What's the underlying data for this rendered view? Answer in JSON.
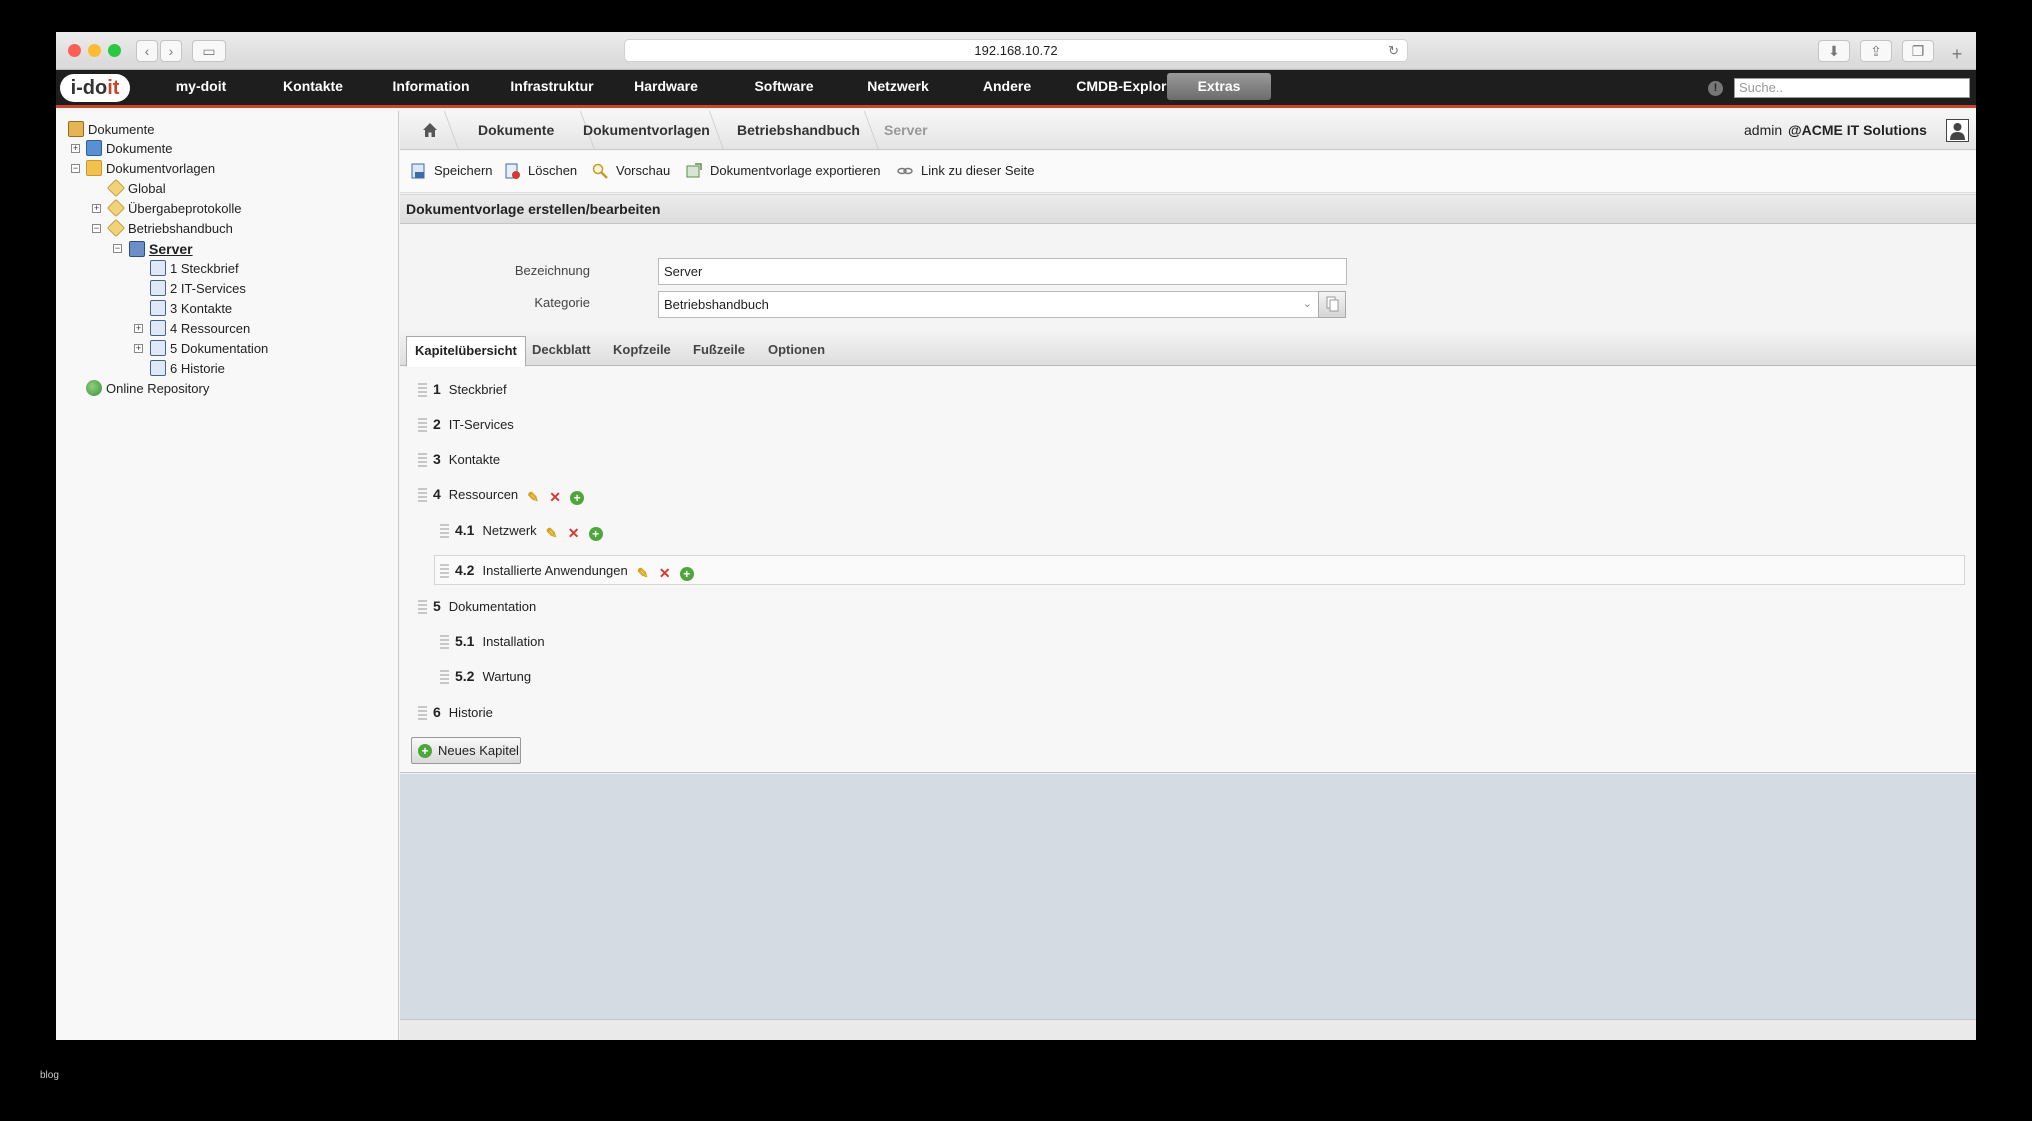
{
  "browser": {
    "url": "192.168.10.72"
  },
  "nav": {
    "logo": "i-doit",
    "items": [
      {
        "label": "my-doit"
      },
      {
        "label": "Kontakte"
      },
      {
        "label": "Information"
      },
      {
        "label": "Infrastruktur"
      },
      {
        "label": "Hardware"
      },
      {
        "label": "Software"
      },
      {
        "label": "Netzwerk"
      },
      {
        "label": "Andere"
      },
      {
        "label": "CMDB-Explorer"
      },
      {
        "label": "Extras"
      }
    ],
    "active": "Extras",
    "search_placeholder": "Suche.."
  },
  "tree": {
    "root": "Dokumente",
    "nodes": [
      {
        "label": "Dokumente"
      },
      {
        "label": "Dokumentvorlagen"
      },
      {
        "label": "Global"
      },
      {
        "label": "Übergabeprotokolle"
      },
      {
        "label": "Betriebshandbuch"
      },
      {
        "label": "Server"
      },
      {
        "label": "1 Steckbrief"
      },
      {
        "label": "2 IT-Services"
      },
      {
        "label": "3 Kontakte"
      },
      {
        "label": "4 Ressourcen"
      },
      {
        "label": "5 Dokumentation"
      },
      {
        "label": "6 Historie"
      },
      {
        "label": "Online Repository"
      }
    ]
  },
  "breadcrumb": {
    "items": [
      {
        "label": "Dokumente"
      },
      {
        "label": "Dokumentvorlagen"
      },
      {
        "label": "Betriebshandbuch"
      },
      {
        "label": "Server"
      }
    ]
  },
  "session": {
    "user": "admin",
    "tenant": "@ACME IT Solutions"
  },
  "toolbar": {
    "save": "Speichern",
    "delete": "Löschen",
    "preview": "Vorschau",
    "export": "Dokumentvorlage exportieren",
    "link": "Link zu dieser Seite"
  },
  "form": {
    "title": "Dokumentvorlage erstellen/bearbeiten",
    "name_label": "Bezeichnung",
    "name_value": "Server",
    "category_label": "Kategorie",
    "category_value": "Betriebshandbuch"
  },
  "tabs": [
    {
      "label": "Kapitelübersicht"
    },
    {
      "label": "Deckblatt"
    },
    {
      "label": "Kopfzeile"
    },
    {
      "label": "Fußzeile"
    },
    {
      "label": "Optionen"
    }
  ],
  "active_tab": "Kapitelübersicht",
  "chapters": [
    {
      "num": "1",
      "title": "Steckbrief"
    },
    {
      "num": "2",
      "title": "IT-Services"
    },
    {
      "num": "3",
      "title": "Kontakte"
    },
    {
      "num": "4",
      "title": "Ressourcen"
    },
    {
      "num": "4.1",
      "title": "Netzwerk"
    },
    {
      "num": "4.2",
      "title": "Installierte Anwendungen"
    },
    {
      "num": "5",
      "title": "Dokumentation"
    },
    {
      "num": "5.1",
      "title": "Installation"
    },
    {
      "num": "5.2",
      "title": "Wartung"
    },
    {
      "num": "6",
      "title": "Historie"
    }
  ],
  "new_chapter_button": "Neues Kapitel",
  "footer_text": "blog",
  "colors": {
    "accent": "#c8462a",
    "nav_bg": "#1e1e1e",
    "bottom_bg": "#d4dbe3"
  }
}
